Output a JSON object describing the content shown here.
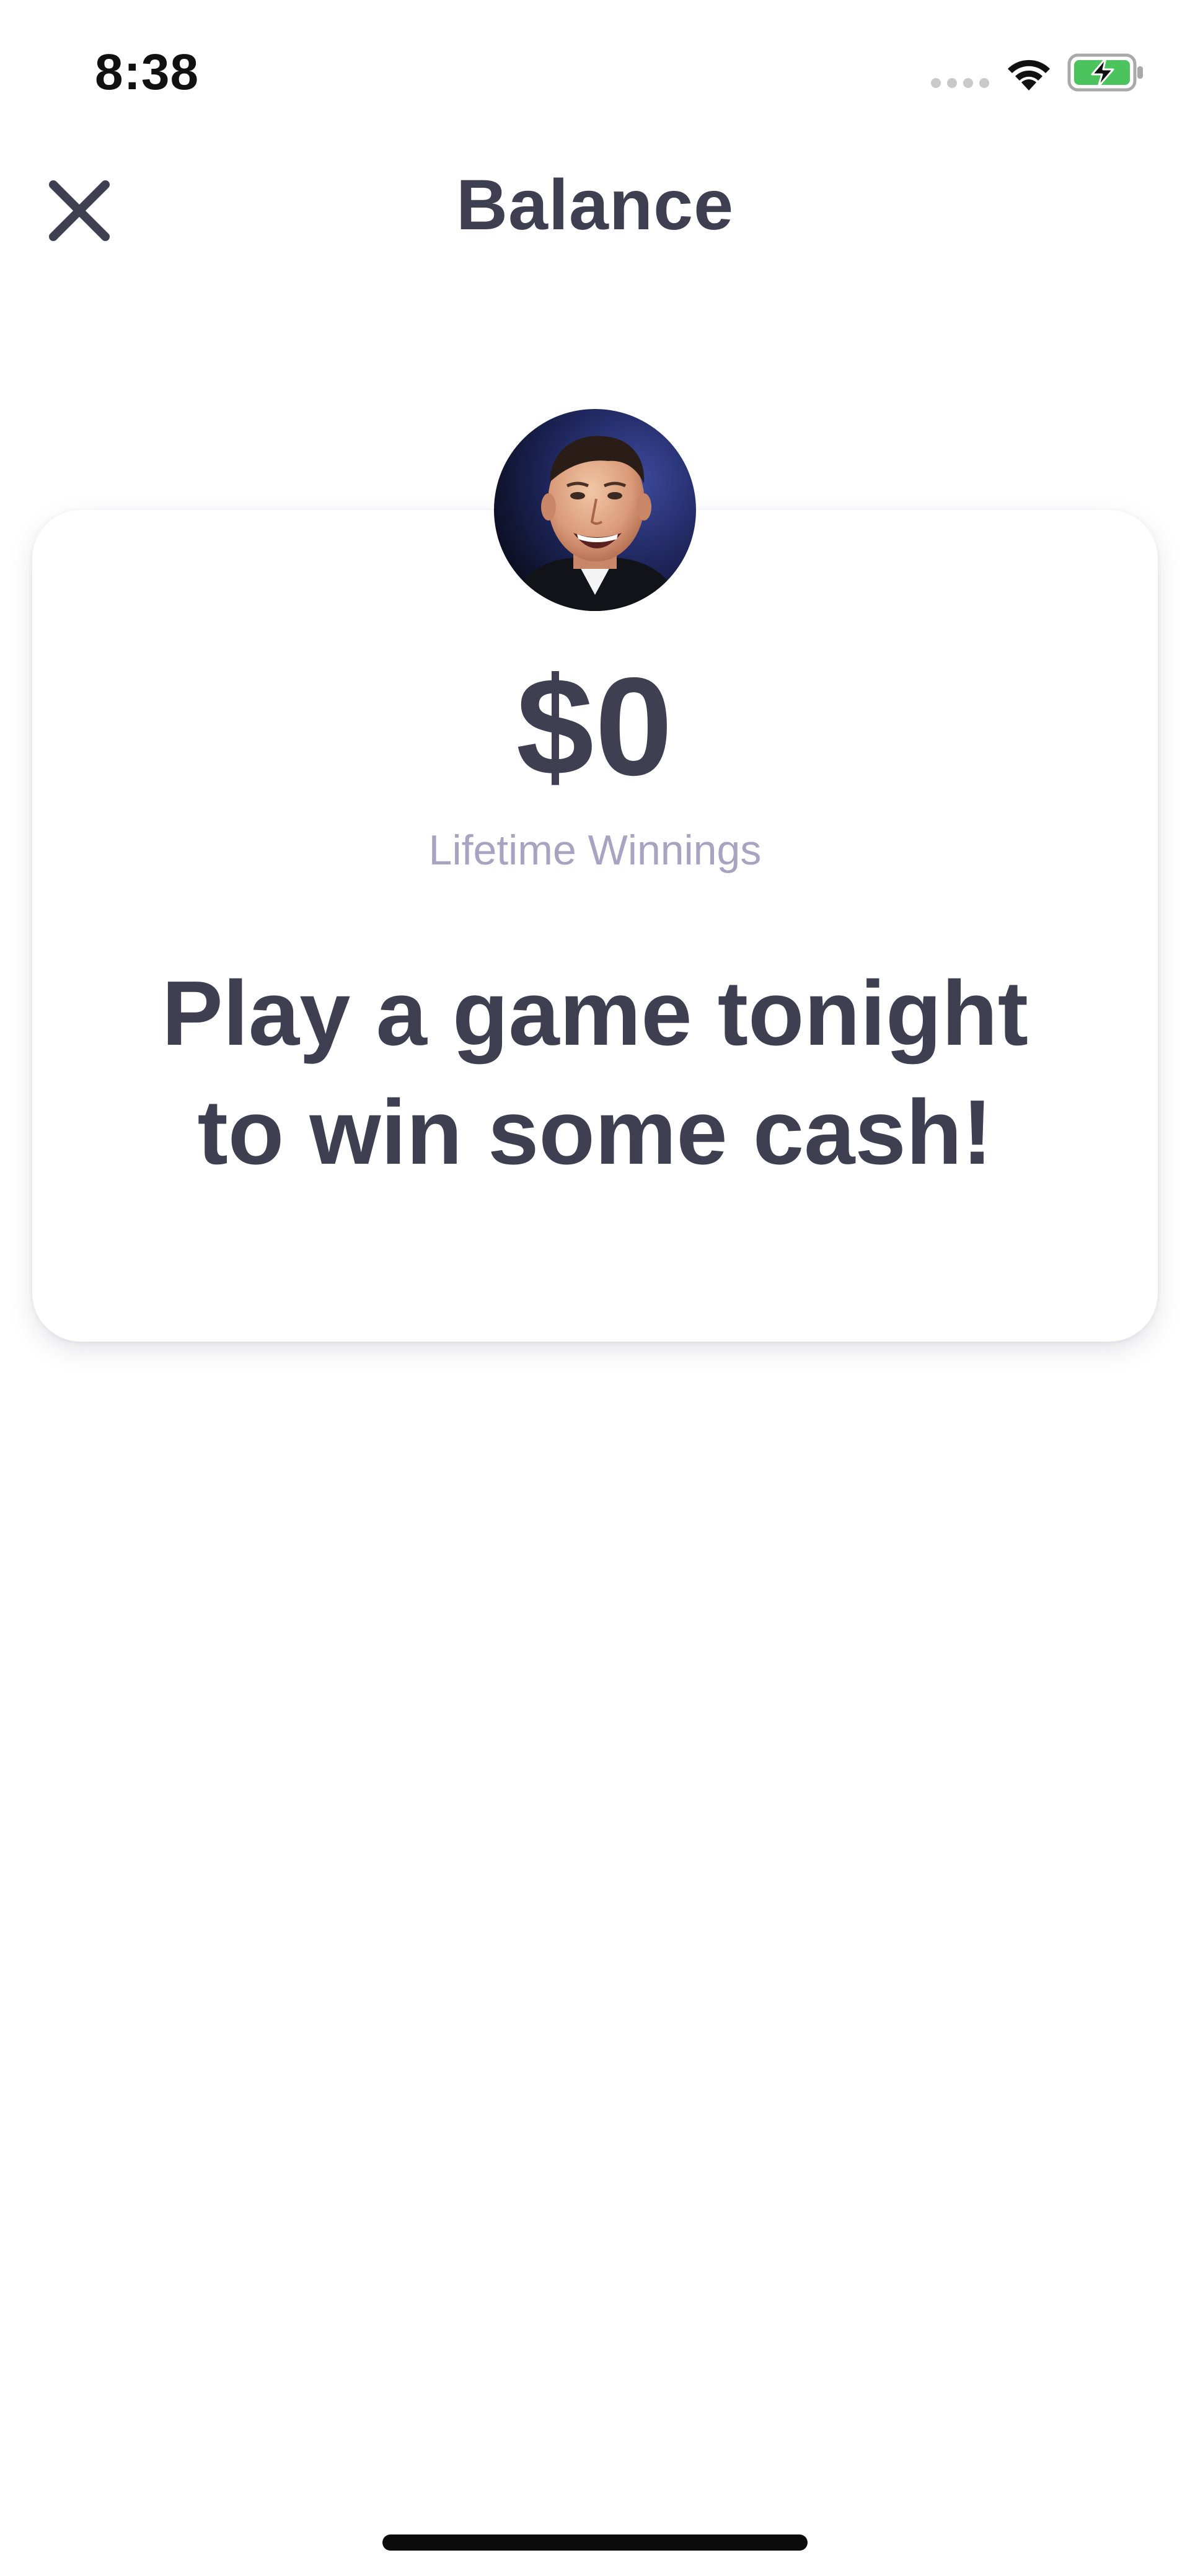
{
  "status_bar": {
    "time": "8:38",
    "icons": [
      "signal-dots-icon",
      "wifi-icon",
      "battery-charging-icon"
    ],
    "battery_color": "#4cc45e"
  },
  "header": {
    "title": "Balance",
    "close_icon": "close-icon"
  },
  "balance_card": {
    "avatar": "user-avatar",
    "amount": "$0",
    "caption": "Lifetime Winnings",
    "promo_line_1": "Play a game tonight",
    "promo_line_2": "to win some cash!"
  },
  "colors": {
    "text_primary": "#3f3f52",
    "text_secondary": "#a7a3c0",
    "background": "#ffffff"
  }
}
